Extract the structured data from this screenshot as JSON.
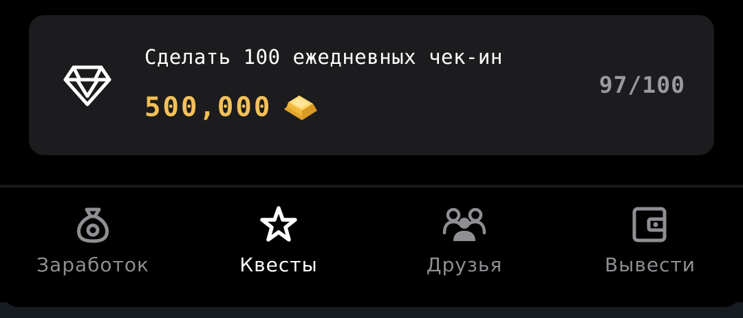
{
  "quest": {
    "title": "Сделать 100 ежедневных чек-ин",
    "reward": "500,000",
    "progress": "97/100",
    "progress_current": 97,
    "progress_total": 100,
    "icon": "diamond-icon",
    "reward_icon": "gold-bar-icon"
  },
  "nav": {
    "items": [
      {
        "label": "Заработок",
        "icon": "money-bag-icon",
        "active": false
      },
      {
        "label": "Квесты",
        "icon": "star-icon",
        "active": true
      },
      {
        "label": "Друзья",
        "icon": "friends-icon",
        "active": false
      },
      {
        "label": "Вывести",
        "icon": "wallet-icon",
        "active": false
      }
    ]
  },
  "colors": {
    "background": "#000000",
    "card": "#1c1c1e",
    "reward": "#f4c058",
    "muted": "#8e8e93",
    "active": "#ffffff"
  }
}
